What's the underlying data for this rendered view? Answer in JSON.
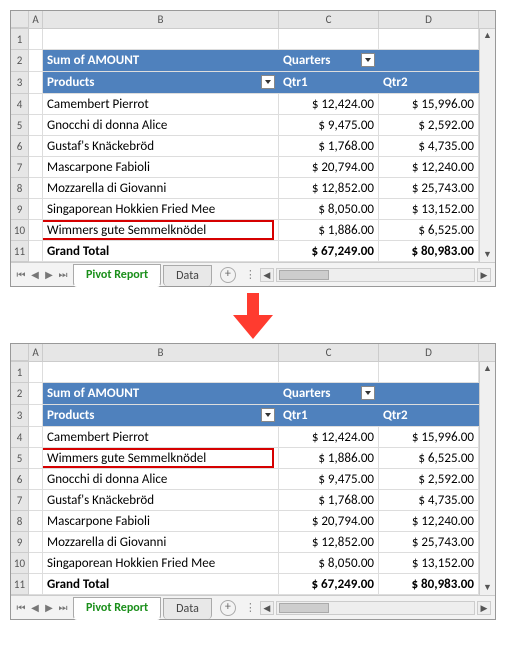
{
  "columns": [
    "A",
    "B",
    "C",
    "D"
  ],
  "top": {
    "rows": [
      "1",
      "2",
      "3",
      "4",
      "5",
      "6",
      "7",
      "8",
      "9",
      "10",
      "11"
    ],
    "header1": {
      "b": "Sum of AMOUNT",
      "c": "Quarters"
    },
    "header2": {
      "b": "Products",
      "c": "Qtr1",
      "d": "Qtr2"
    },
    "data": [
      {
        "b": "Camembert Pierrot",
        "c": "$ 12,424.00",
        "d": "$ 15,996.00"
      },
      {
        "b": "Gnocchi di donna Alice",
        "c": "$ 9,475.00",
        "d": "$ 2,592.00"
      },
      {
        "b": "Gustaf's Knäckebröd",
        "c": "$ 1,768.00",
        "d": "$ 4,735.00"
      },
      {
        "b": "Mascarpone Fabioli",
        "c": "$ 20,794.00",
        "d": "$ 12,240.00"
      },
      {
        "b": "Mozzarella di Giovanni",
        "c": "$ 12,852.00",
        "d": "$ 25,743.00"
      },
      {
        "b": "Singaporean Hokkien Fried Mee",
        "c": "$ 8,050.00",
        "d": "$ 13,152.00"
      },
      {
        "b": "Wimmers gute Semmelknödel",
        "c": "$ 1,886.00",
        "d": "$ 6,525.00",
        "hl": true
      }
    ],
    "total": {
      "b": "Grand Total",
      "c": "$ 67,249.00",
      "d": "$ 80,983.00"
    }
  },
  "bottom": {
    "rows": [
      "1",
      "2",
      "3",
      "4",
      "5",
      "6",
      "7",
      "8",
      "9",
      "10",
      "11"
    ],
    "header1": {
      "b": "Sum of AMOUNT",
      "c": "Quarters"
    },
    "header2": {
      "b": "Products",
      "c": "Qtr1",
      "d": "Qtr2"
    },
    "data": [
      {
        "b": "Camembert Pierrot",
        "c": "$ 12,424.00",
        "d": "$ 15,996.00"
      },
      {
        "b": "Wimmers gute Semmelknödel",
        "c": "$ 1,886.00",
        "d": "$ 6,525.00",
        "hl": true
      },
      {
        "b": "Gnocchi di donna Alice",
        "c": "$ 9,475.00",
        "d": "$ 2,592.00"
      },
      {
        "b": "Gustaf's Knäckebröd",
        "c": "$ 1,768.00",
        "d": "$ 4,735.00"
      },
      {
        "b": "Mascarpone Fabioli",
        "c": "$ 20,794.00",
        "d": "$ 12,240.00"
      },
      {
        "b": "Mozzarella di Giovanni",
        "c": "$ 12,852.00",
        "d": "$ 25,743.00"
      },
      {
        "b": "Singaporean Hokkien Fried Mee",
        "c": "$ 8,050.00",
        "d": "$ 13,152.00"
      }
    ],
    "total": {
      "b": "Grand Total",
      "c": "$ 67,249.00",
      "d": "$ 80,983.00"
    }
  },
  "tabs": {
    "active": "Pivot Report",
    "other": "Data"
  }
}
